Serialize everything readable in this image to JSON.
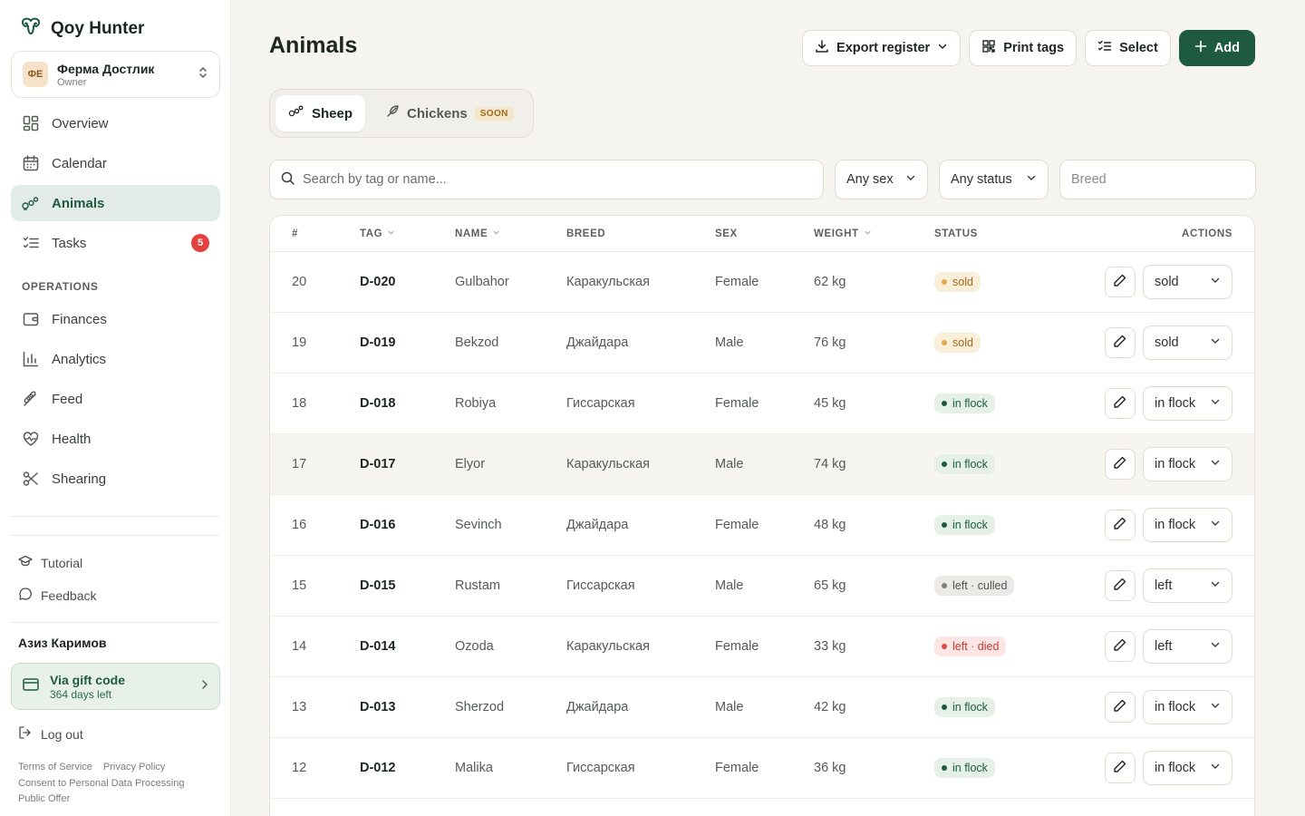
{
  "brand": {
    "name": "Qoy Hunter"
  },
  "farm": {
    "avatar": "ФЕ",
    "name": "Ферма Достлик",
    "role": "Owner"
  },
  "nav": [
    {
      "label": "Overview",
      "icon": "grid-icon"
    },
    {
      "label": "Calendar",
      "icon": "calendar-icon"
    },
    {
      "label": "Animals",
      "icon": "sheep-icon",
      "active": true
    },
    {
      "label": "Tasks",
      "icon": "checklist-icon",
      "badge": "5"
    }
  ],
  "operations_label": "OPERATIONS",
  "operations": [
    {
      "label": "Finances",
      "icon": "wallet-icon"
    },
    {
      "label": "Analytics",
      "icon": "bar-chart-icon"
    },
    {
      "label": "Feed",
      "icon": "wheat-icon"
    },
    {
      "label": "Health",
      "icon": "heart-pulse-icon"
    },
    {
      "label": "Shearing",
      "icon": "scissors-icon"
    }
  ],
  "bottom": {
    "tutorial": "Tutorial",
    "feedback": "Feedback",
    "logout": "Log out"
  },
  "user": {
    "name": "Азиз Каримов"
  },
  "gift": {
    "title": "Via gift code",
    "sub": "364 days left"
  },
  "legal": {
    "terms": "Terms of Service",
    "privacy": "Privacy Policy",
    "consent": "Consent to Personal Data Processing",
    "offer": "Public Offer"
  },
  "page": {
    "title": "Animals"
  },
  "actions": {
    "export": "Export register",
    "print": "Print tags",
    "select": "Select",
    "add": "Add"
  },
  "tabs": {
    "sheep": "Sheep",
    "chickens": "Chickens",
    "soon": "SOON"
  },
  "filters": {
    "search_placeholder": "Search by tag or name...",
    "sex": "Any sex",
    "status": "Any status",
    "breed_placeholder": "Breed"
  },
  "columns": {
    "num": "#",
    "tag": "TAG",
    "name": "NAME",
    "breed": "BREED",
    "sex": "SEX",
    "weight": "WEIGHT",
    "status": "STATUS",
    "actions": "ACTIONS"
  },
  "rows": [
    {
      "num": "20",
      "tag": "D-020",
      "name": "Gulbahor",
      "breed": "Каракульская",
      "sex": "Female",
      "weight": "62 kg",
      "status": "sold",
      "status_kind": "sold",
      "select": "sold"
    },
    {
      "num": "19",
      "tag": "D-019",
      "name": "Bekzod",
      "breed": "Джайдара",
      "sex": "Male",
      "weight": "76 kg",
      "status": "sold",
      "status_kind": "sold",
      "select": "sold"
    },
    {
      "num": "18",
      "tag": "D-018",
      "name": "Robiya",
      "breed": "Гиссарская",
      "sex": "Female",
      "weight": "45 kg",
      "status": "in flock",
      "status_kind": "flock",
      "select": "in flock"
    },
    {
      "num": "17",
      "tag": "D-017",
      "name": "Elyor",
      "breed": "Каракульская",
      "sex": "Male",
      "weight": "74 kg",
      "status": "in flock",
      "status_kind": "flock",
      "select": "in flock",
      "highlight": true
    },
    {
      "num": "16",
      "tag": "D-016",
      "name": "Sevinch",
      "breed": "Джайдара",
      "sex": "Female",
      "weight": "48 kg",
      "status": "in flock",
      "status_kind": "flock",
      "select": "in flock"
    },
    {
      "num": "15",
      "tag": "D-015",
      "name": "Rustam",
      "breed": "Гиссарская",
      "sex": "Male",
      "weight": "65 kg",
      "status": "left · culled",
      "status_kind": "culled",
      "select": "left"
    },
    {
      "num": "14",
      "tag": "D-014",
      "name": "Ozoda",
      "breed": "Каракульская",
      "sex": "Female",
      "weight": "33 kg",
      "status": "left · died",
      "status_kind": "died",
      "select": "left"
    },
    {
      "num": "13",
      "tag": "D-013",
      "name": "Sherzod",
      "breed": "Джайдара",
      "sex": "Male",
      "weight": "42 kg",
      "status": "in flock",
      "status_kind": "flock",
      "select": "in flock"
    },
    {
      "num": "12",
      "tag": "D-012",
      "name": "Malika",
      "breed": "Гиссарская",
      "sex": "Female",
      "weight": "36 kg",
      "status": "in flock",
      "status_kind": "flock",
      "select": "in flock"
    }
  ],
  "colors": {
    "accent": "#1e5a3f",
    "badge": "#e3413d",
    "background": "#f6f4ef"
  }
}
